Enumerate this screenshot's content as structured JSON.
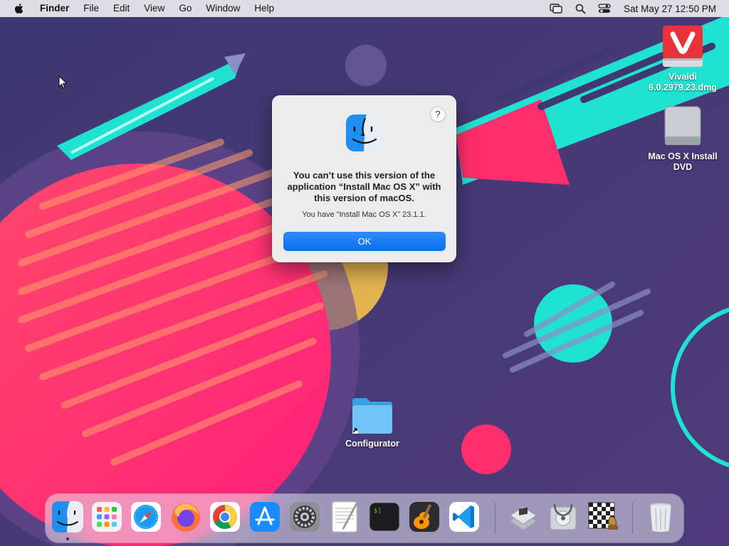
{
  "menubar": {
    "app_name": "Finder",
    "menus": [
      "File",
      "Edit",
      "View",
      "Go",
      "Window",
      "Help"
    ],
    "status_icons": [
      "screen-mirroring-icon",
      "spotlight-search-icon",
      "control-center-icon"
    ],
    "clock": "Sat May 27  12:50 PM"
  },
  "desktop": {
    "icons": [
      {
        "label": "Vivaldi 6.0.2979.23.dmg",
        "icon": "disk-image-icon"
      },
      {
        "label": "Mac OS X Install DVD",
        "icon": "hard-drive-icon"
      },
      {
        "label": "Configurator",
        "icon": "folder-alias-icon"
      }
    ]
  },
  "dialog": {
    "message": "You can’t use this version of the application “Install Mac OS X” with this version of macOS.",
    "info": "You have “Install Mac OS X” 23.1.1.",
    "ok_label": "OK",
    "help_label": "?",
    "icon": "finder-icon"
  },
  "dock": {
    "apps": [
      {
        "name": "Finder",
        "icon": "finder-icon",
        "running": true
      },
      {
        "name": "Launchpad",
        "icon": "launchpad-icon",
        "running": false
      },
      {
        "name": "Safari",
        "icon": "safari-icon",
        "running": false
      },
      {
        "name": "Firefox",
        "icon": "firefox-icon",
        "running": false
      },
      {
        "name": "Google Chrome",
        "icon": "chrome-icon",
        "running": false
      },
      {
        "name": "App Store",
        "icon": "app-store-icon",
        "running": false
      },
      {
        "name": "System Preferences",
        "icon": "system-preferences-icon",
        "running": false
      },
      {
        "name": "TextEdit",
        "icon": "textedit-icon",
        "running": false
      },
      {
        "name": "Terminal",
        "icon": "terminal-icon",
        "running": false
      },
      {
        "name": "GarageBand",
        "icon": "garageband-icon",
        "running": false
      },
      {
        "name": "Visual Studio Code",
        "icon": "vscode-icon",
        "running": false
      },
      {
        "name": "Boot Camp Assistant",
        "icon": "boot-camp-icon",
        "running": false
      },
      {
        "name": "Disk Utility",
        "icon": "disk-utility-icon",
        "running": false
      },
      {
        "name": "Chess",
        "icon": "chess-icon",
        "running": false
      },
      {
        "name": "Trash",
        "icon": "trash-icon",
        "running": false
      }
    ]
  },
  "colors": {
    "wallpaper_base": "#4b3a78",
    "accent_blue": "#0a6fe9",
    "pink": "#ff2e6e",
    "teal": "#1fe3d0"
  }
}
